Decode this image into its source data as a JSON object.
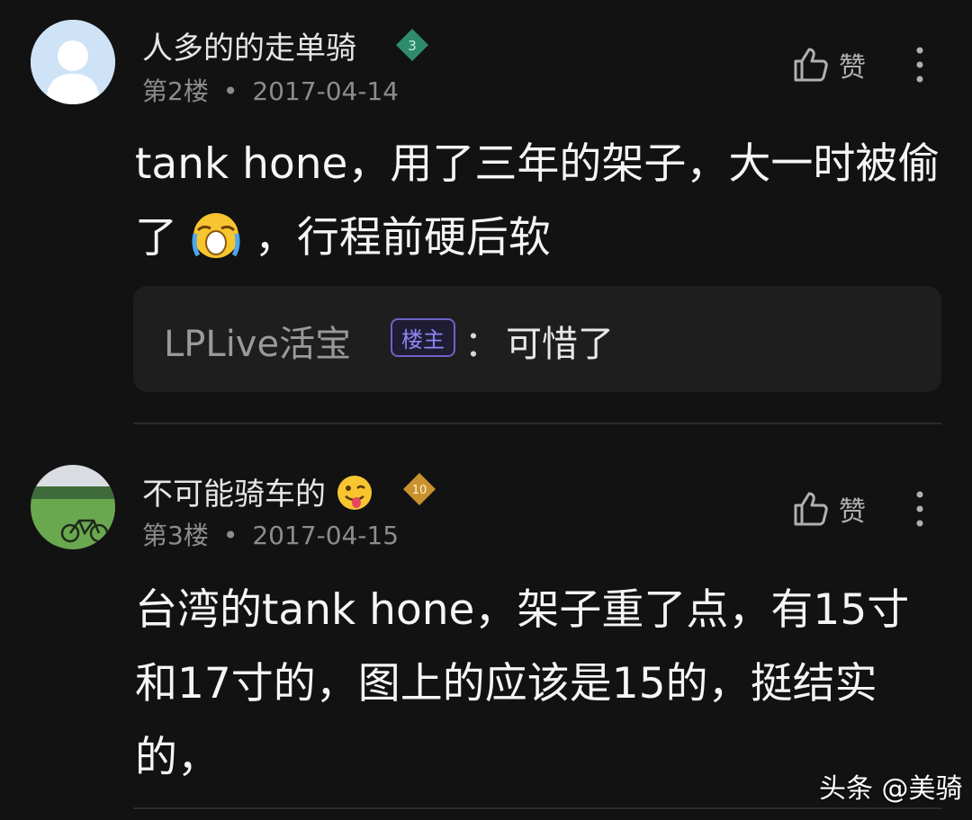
{
  "comments": [
    {
      "username": "人多的的走单骑",
      "level": "3",
      "floor": "第2楼",
      "separator": "•",
      "date": "2017-04-14",
      "like_label": "赞",
      "text_part1": "tank hone，用了三年的架子，大一时被偷了",
      "emoji": "crying-face-emoji",
      "text_part2": "，行程前硬后软",
      "reply": {
        "user": "LPLive活宝",
        "tag": "楼主",
        "colon": "：",
        "text": "可惜了"
      }
    },
    {
      "username": "不可能骑车的",
      "username_emoji": "winking-tongue-emoji",
      "level": "10",
      "floor": "第3楼",
      "separator": "•",
      "date": "2017-04-15",
      "like_label": "赞",
      "text": "台湾的tank hone，架子重了点，有15寸和17寸的，图上的应该是15的，挺结实的，"
    }
  ],
  "watermark": "头条 @美骑",
  "colors": {
    "background": "#121212",
    "level3_badge": "#2e8b6e",
    "level10_badge": "#c9922e",
    "op_tag": "#8e86f5"
  }
}
